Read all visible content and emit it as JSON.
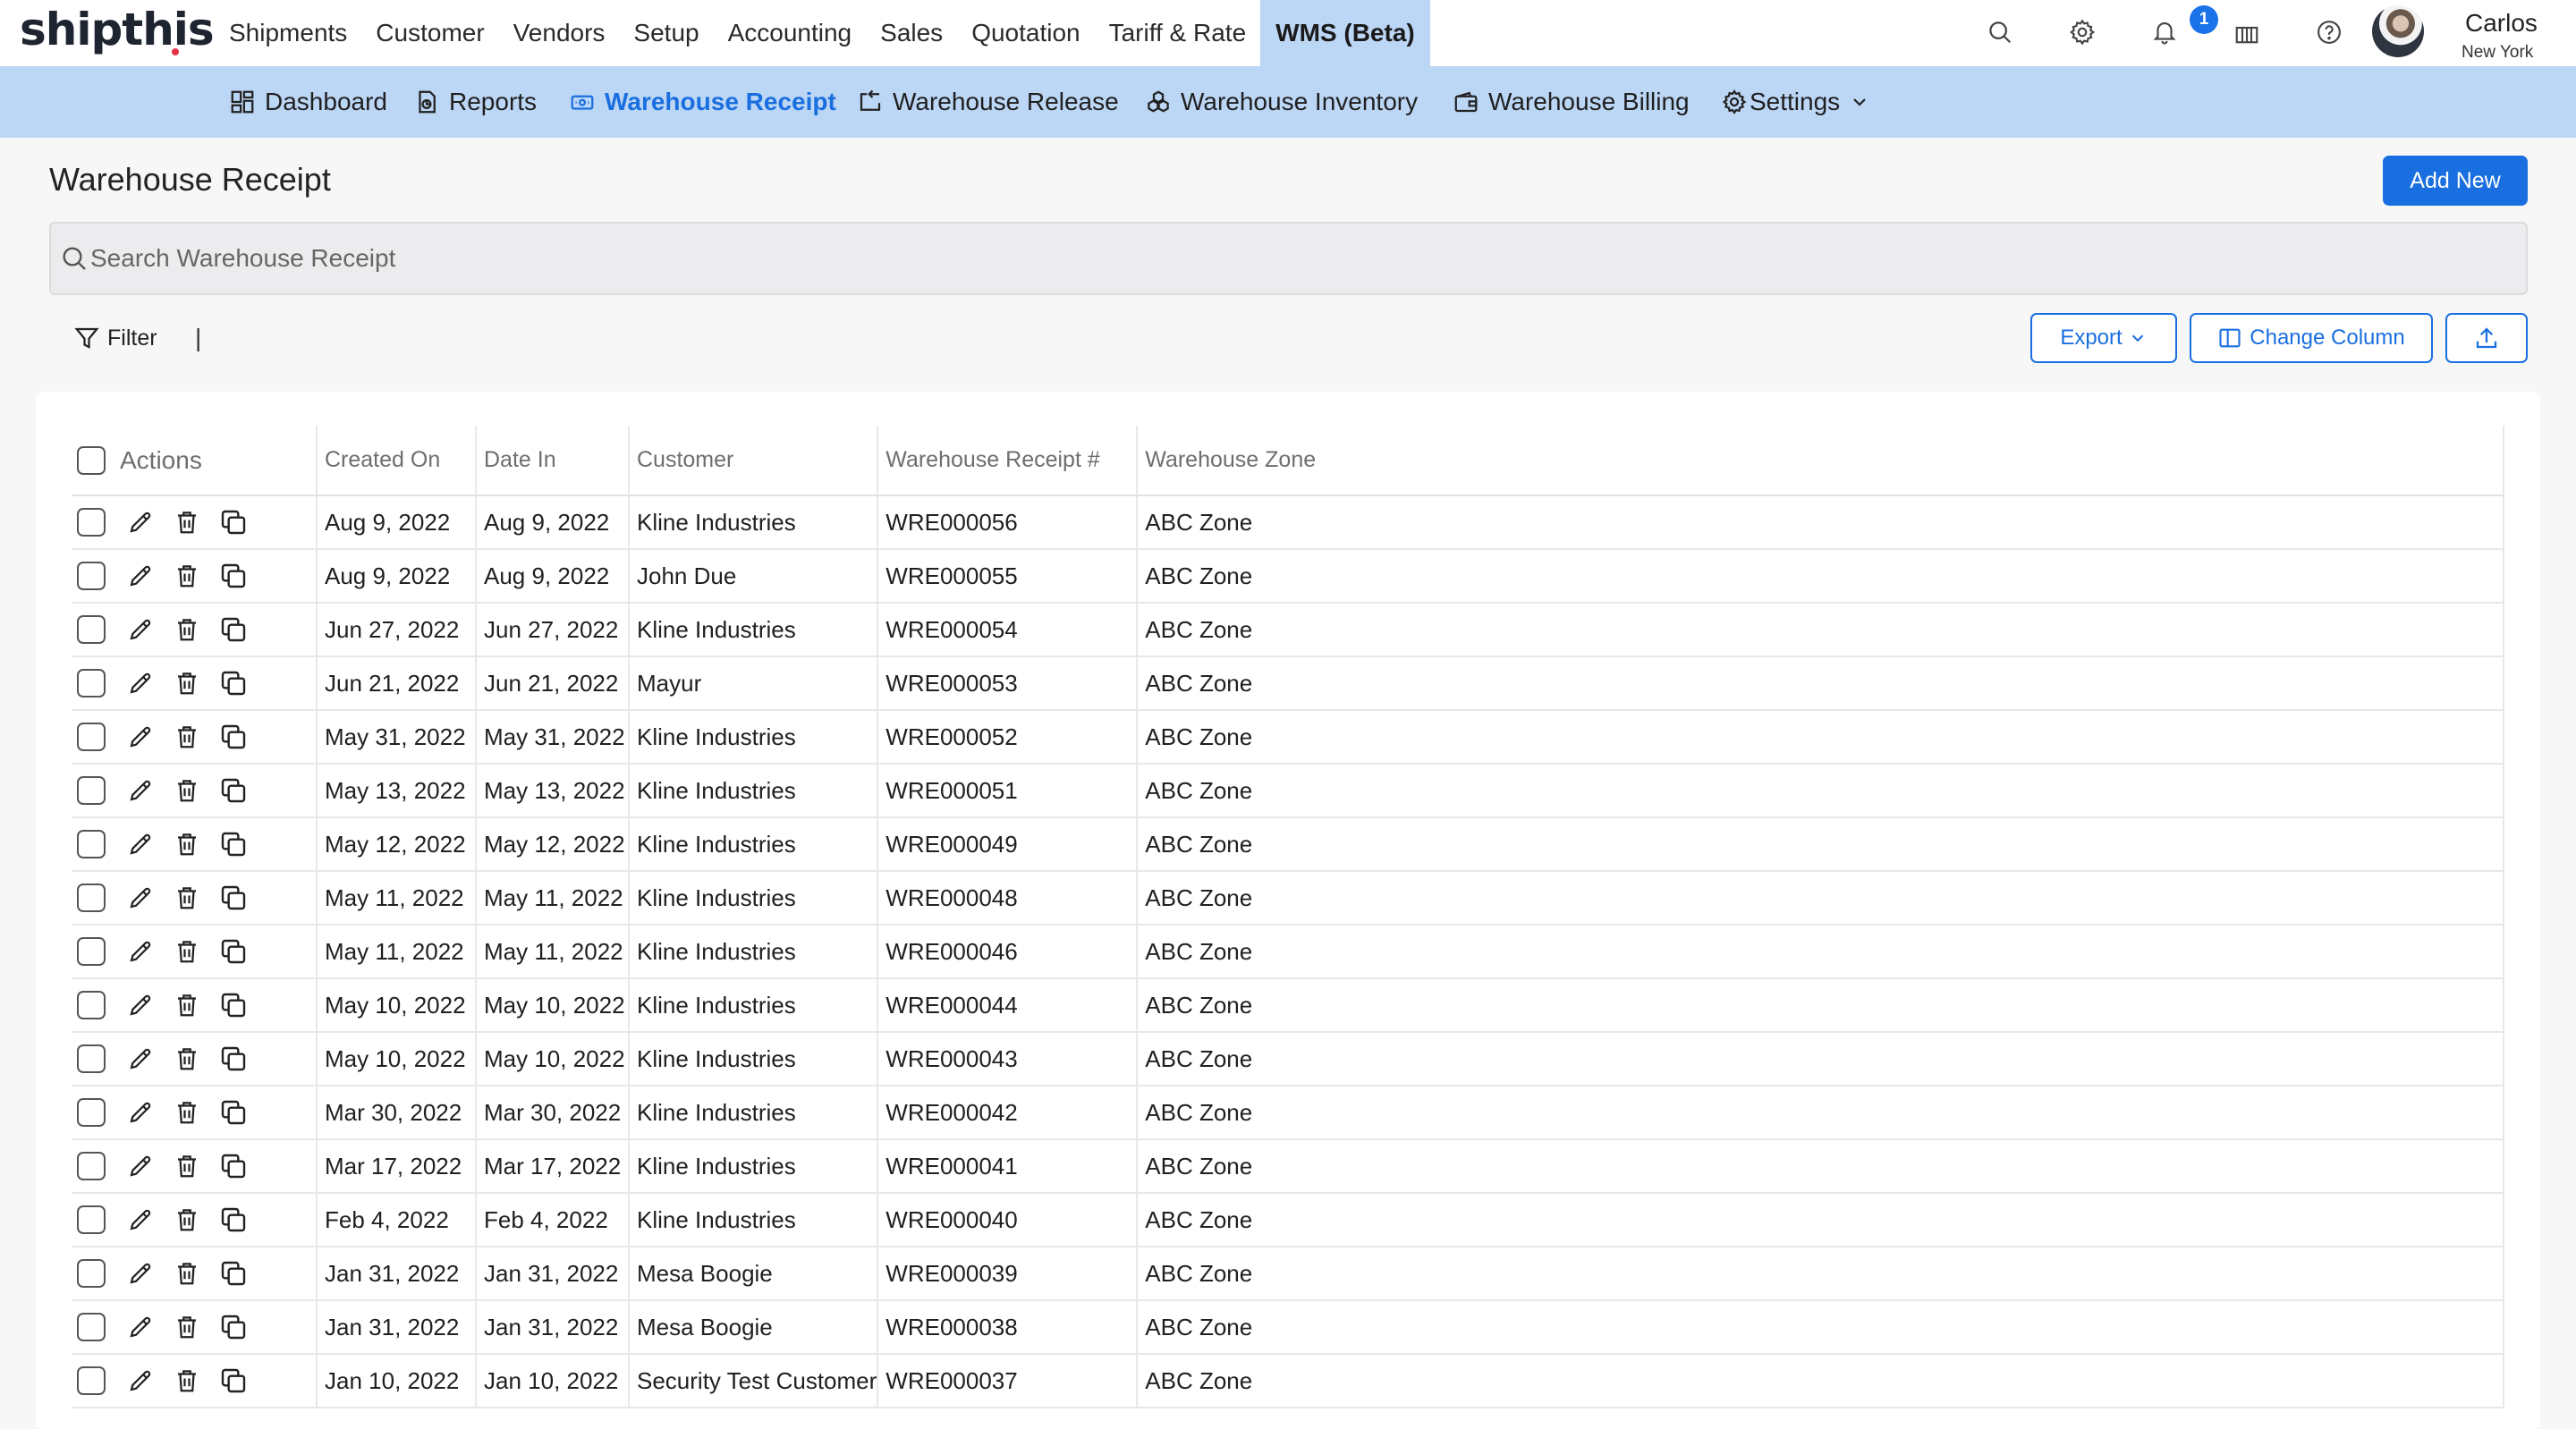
{
  "brand": {
    "logo_text": "shipthis"
  },
  "topnav": {
    "items": [
      "Shipments",
      "Customer",
      "Vendors",
      "Setup",
      "Accounting",
      "Sales",
      "Quotation",
      "Tariff & Rate",
      "WMS (Beta)"
    ],
    "active": "WMS (Beta)"
  },
  "notifications": {
    "count": "1"
  },
  "user": {
    "name": "Carlos",
    "location": "New York"
  },
  "subnav": {
    "dashboard": "Dashboard",
    "reports": "Reports",
    "warehouse_receipt": "Warehouse Receipt",
    "warehouse_release": "Warehouse Release",
    "warehouse_inventory": "Warehouse Inventory",
    "warehouse_billing": "Warehouse Billing",
    "settings": "Settings"
  },
  "page": {
    "title": "Warehouse Receipt",
    "add_new": "Add New",
    "search_placeholder": "Search Warehouse Receipt",
    "filter": "Filter",
    "pipe": "|",
    "export": "Export",
    "change_column": "Change Column"
  },
  "colors": {
    "accent": "#1a6fe0",
    "subnav_bg": "#bcd6f5"
  },
  "table": {
    "headers": {
      "actions": "Actions",
      "created_on": "Created On",
      "date_in": "Date In",
      "customer": "Customer",
      "receipt_no": "Warehouse Receipt #",
      "zone": "Warehouse Zone"
    },
    "rows": [
      {
        "created": "Aug 9, 2022",
        "date_in": "Aug 9, 2022",
        "customer": "Kline Industries",
        "receipt": "WRE000056",
        "zone": "ABC Zone"
      },
      {
        "created": "Aug 9, 2022",
        "date_in": "Aug 9, 2022",
        "customer": "John Due",
        "receipt": "WRE000055",
        "zone": "ABC Zone"
      },
      {
        "created": "Jun 27, 2022",
        "date_in": "Jun 27, 2022",
        "customer": "Kline Industries",
        "receipt": "WRE000054",
        "zone": "ABC Zone"
      },
      {
        "created": "Jun 21, 2022",
        "date_in": "Jun 21, 2022",
        "customer": "Mayur",
        "receipt": "WRE000053",
        "zone": "ABC Zone"
      },
      {
        "created": "May 31, 2022",
        "date_in": "May 31, 2022",
        "customer": "Kline Industries",
        "receipt": "WRE000052",
        "zone": "ABC Zone"
      },
      {
        "created": "May 13, 2022",
        "date_in": "May 13, 2022",
        "customer": "Kline Industries",
        "receipt": "WRE000051",
        "zone": "ABC Zone"
      },
      {
        "created": "May 12, 2022",
        "date_in": "May 12, 2022",
        "customer": "Kline Industries",
        "receipt": "WRE000049",
        "zone": "ABC Zone"
      },
      {
        "created": "May 11, 2022",
        "date_in": "May 11, 2022",
        "customer": "Kline Industries",
        "receipt": "WRE000048",
        "zone": "ABC Zone"
      },
      {
        "created": "May 11, 2022",
        "date_in": "May 11, 2022",
        "customer": "Kline Industries",
        "receipt": "WRE000046",
        "zone": "ABC Zone"
      },
      {
        "created": "May 10, 2022",
        "date_in": "May 10, 2022",
        "customer": "Kline Industries",
        "receipt": "WRE000044",
        "zone": "ABC Zone"
      },
      {
        "created": "May 10, 2022",
        "date_in": "May 10, 2022",
        "customer": "Kline Industries",
        "receipt": "WRE000043",
        "zone": "ABC Zone"
      },
      {
        "created": "Mar 30, 2022",
        "date_in": "Mar 30, 2022",
        "customer": "Kline Industries",
        "receipt": "WRE000042",
        "zone": "ABC Zone"
      },
      {
        "created": "Mar 17, 2022",
        "date_in": "Mar 17, 2022",
        "customer": "Kline Industries",
        "receipt": "WRE000041",
        "zone": "ABC Zone"
      },
      {
        "created": "Feb 4, 2022",
        "date_in": "Feb 4, 2022",
        "customer": "Kline Industries",
        "receipt": "WRE000040",
        "zone": "ABC Zone"
      },
      {
        "created": "Jan 31, 2022",
        "date_in": "Jan 31, 2022",
        "customer": "Mesa Boogie",
        "receipt": "WRE000039",
        "zone": "ABC Zone"
      },
      {
        "created": "Jan 31, 2022",
        "date_in": "Jan 31, 2022",
        "customer": "Mesa Boogie",
        "receipt": "WRE000038",
        "zone": "ABC Zone"
      },
      {
        "created": "Jan 10, 2022",
        "date_in": "Jan 10, 2022",
        "customer": "Security Test Customer",
        "receipt": "WRE000037",
        "zone": "ABC Zone"
      }
    ]
  }
}
